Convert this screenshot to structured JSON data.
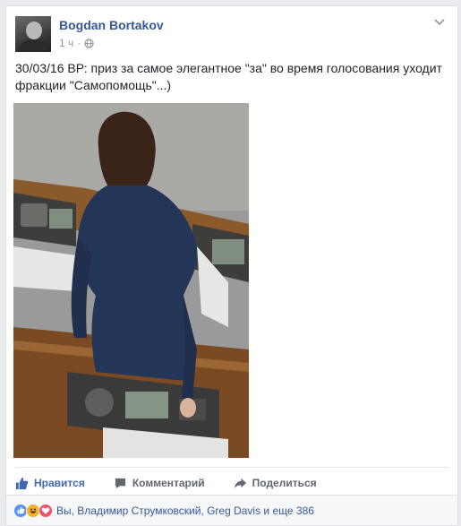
{
  "post": {
    "author": "Bogdan Bortakov",
    "time": "1 ч",
    "text": "30/03/16 ВР: приз за самое элегантное \"за\" во время голосования уходит фракции \"Самопомощь\"...)",
    "icons": {
      "privacy": "globe-icon",
      "menu": "chevron-down-icon"
    }
  },
  "actions": {
    "like_label": "Нравится",
    "comment_label": "Комментарий",
    "share_label": "Поделиться"
  },
  "reactions": {
    "icons": [
      "like-reaction-icon",
      "haha-reaction-icon",
      "love-reaction-icon"
    ],
    "summary": "Вы, Владимир Струмковский, Greg Davis и еще 386"
  },
  "colors": {
    "link": "#365899",
    "like_active": "#4267b2",
    "muted": "#90949c",
    "background": "#e9ebee"
  }
}
